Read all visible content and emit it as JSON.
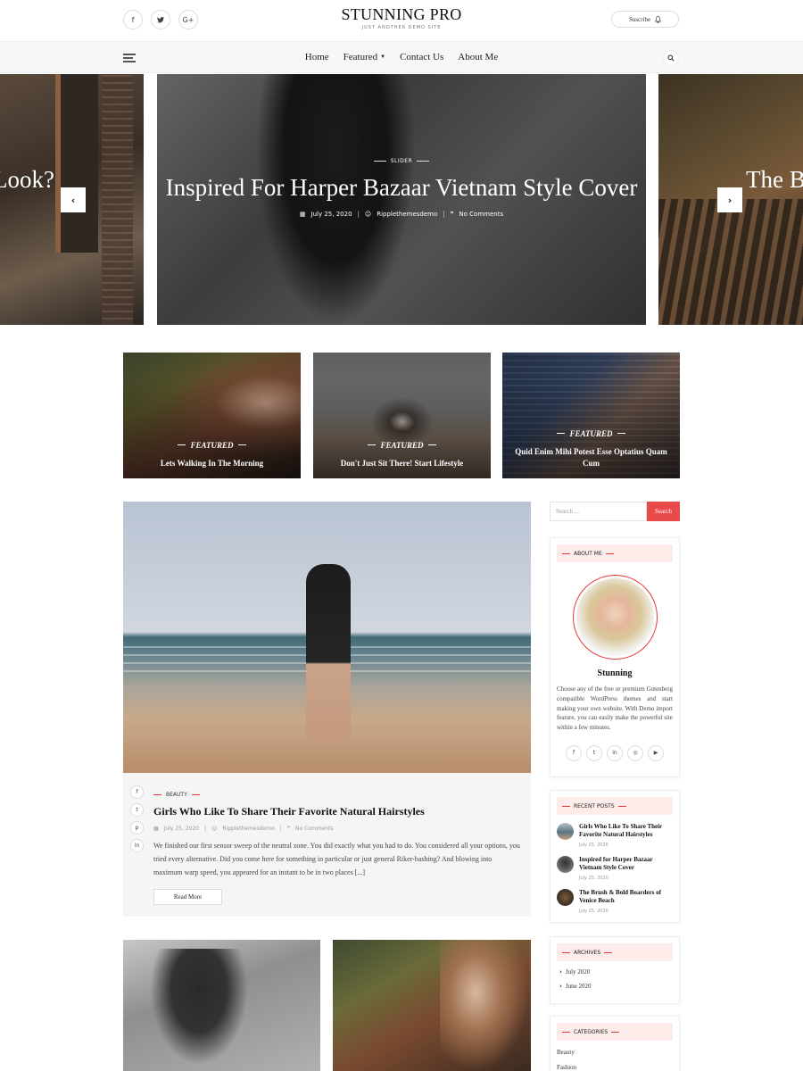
{
  "header": {
    "site_title": "STUNNING PRO",
    "tagline": "JUST ANOTHER DEMO SITE",
    "social_icons": [
      "f",
      "♥",
      "G+"
    ],
    "subscribe_label": "Suscribe"
  },
  "nav": {
    "items": [
      {
        "label": "Home"
      },
      {
        "label": "Featured",
        "has_dropdown": true
      },
      {
        "label": "Contact Us"
      },
      {
        "label": "About Me"
      }
    ]
  },
  "slider": {
    "prev_partial_title": "Look?",
    "next_partial_title": "The B",
    "category": "SLIDER",
    "title": "Inspired For Harper Bazaar Vietnam Style Cover",
    "date": "July 25, 2020",
    "author": "Ripplethemesdemo",
    "comments": "No Comments"
  },
  "featured": [
    {
      "label": "FEATURED",
      "title": "Lets Walking In The Morning"
    },
    {
      "label": "FEATURED",
      "title": "Don't Just Sit There! Start Lifestyle"
    },
    {
      "label": "FEATURED",
      "title": "Quid Enim Mihi Potest Esse Optatius Quam Cum"
    }
  ],
  "main_post": {
    "category": "BEAUTY",
    "title": "Girls Who Like To Share Their Favorite Natural Hairstyles",
    "date": "July 25, 2020",
    "author": "Ripplethemesdemo",
    "comments": "No Comments",
    "excerpt": "We finished our first sensor sweep of the neutral zone. You did exactly what you had to do. You considered all your options, you tried every alternative. Did you come here for something in particular or just general Riker-bashing? And blowing into maximum warp speed, you appeared for an instant to be in two places [...]",
    "read_more": "Read More"
  },
  "sidebar": {
    "search_placeholder": "Search ...",
    "search_button": "Search",
    "about": {
      "title": "ABOUT ME",
      "name": "Stunning",
      "text": "Choose any of the free or premium Gutenberg compatible WordPress themes and start making your own website. With Demo import feature, you can easily make the powerful site within a few minutes."
    },
    "recent": {
      "title": "RECENT POSTS",
      "items": [
        {
          "title": "Girls Who Like To Share Their Favorite Natural Hairstyles",
          "date": "July 25, 2020"
        },
        {
          "title": "Inspired for Harper Bazaar Vietnam Style Cover",
          "date": "July 25, 2020"
        },
        {
          "title": "The Brush & Bold Boarders of Venice Beach",
          "date": "July 25, 2020"
        }
      ]
    },
    "archives": {
      "title": "ARCHIVES",
      "items": [
        "July 2020",
        "June 2020"
      ]
    },
    "categories": {
      "title": "CATEGORIES",
      "items": [
        "Beauty",
        "Fashion"
      ]
    }
  }
}
